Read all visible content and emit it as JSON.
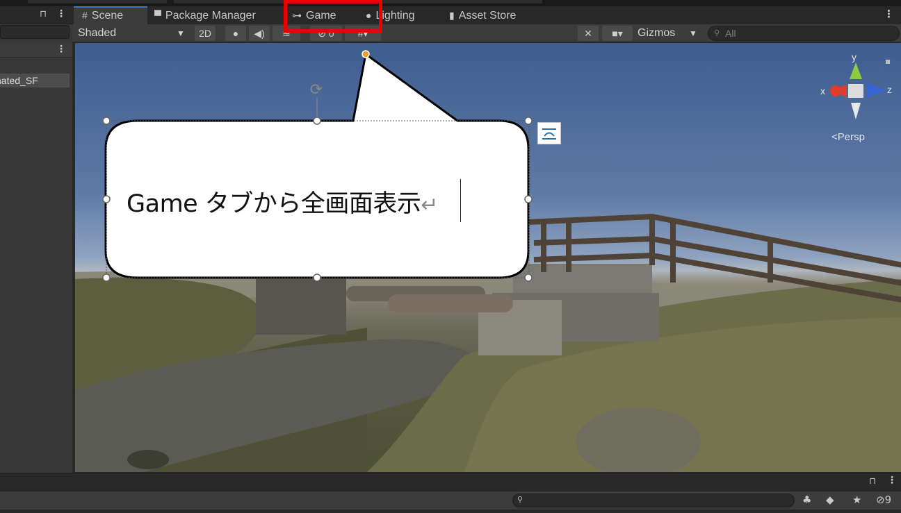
{
  "hierarchy": {
    "item_label": "nated_SF"
  },
  "tabs": [
    {
      "label": "Scene",
      "icon": "#"
    },
    {
      "label": "Package Manager",
      "icon": "▀"
    },
    {
      "label": "Game",
      "icon": "⊶"
    },
    {
      "label": "Lighting",
      "icon": "●"
    },
    {
      "label": "Asset Store",
      "icon": "▮"
    }
  ],
  "toolbar": {
    "shading_mode": "Shaded",
    "toggle_2d": "2D",
    "hidden_count": "0",
    "gizmos_label": "Gizmos",
    "search_placeholder": "All"
  },
  "viewport": {
    "axis_y": "y",
    "axis_x": "x",
    "axis_z": "z",
    "projection": "<Persp"
  },
  "annotation": {
    "bubble_text": "Game タブから全画面表示",
    "return_mark": "↵"
  },
  "bottom": {
    "hidden_count": "9"
  },
  "colors": {
    "highlight": "#ee0000",
    "accent": "#3a79bb"
  }
}
